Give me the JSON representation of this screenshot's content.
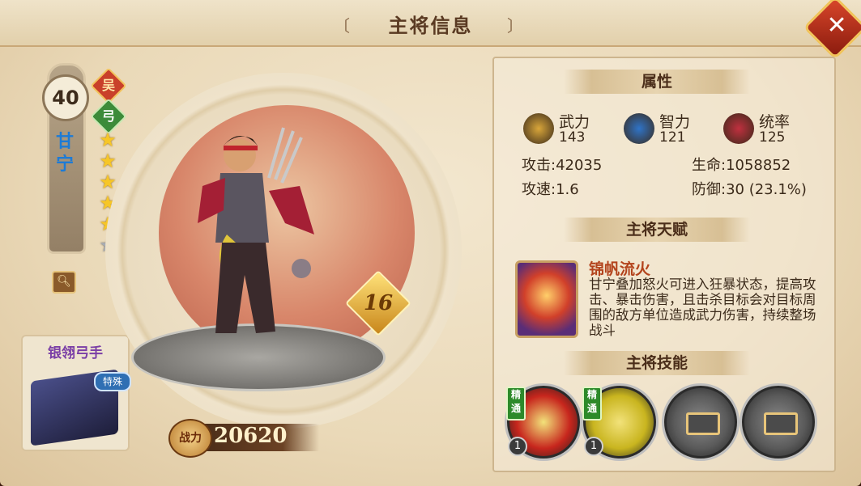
{
  "header": {
    "title": "主将信息",
    "close_label": "✕"
  },
  "hero": {
    "level": "40",
    "name": "甘宁",
    "badge_top": "吴",
    "badge_second": "弓",
    "stars": [
      true,
      true,
      true,
      true,
      true,
      false
    ],
    "star_glyph": "★",
    "rank_badge": "16",
    "power_label": "战力",
    "power_value": "20620"
  },
  "troop": {
    "name": "银翎弓手",
    "tag": "特殊"
  },
  "attributes": {
    "section_title": "属性",
    "items": [
      {
        "label": "武力",
        "value": "143",
        "icon": "sword-icon",
        "color": "#d9a63a"
      },
      {
        "label": "智力",
        "value": "121",
        "icon": "scroll-icon",
        "color": "#2f74c8"
      },
      {
        "label": "统率",
        "value": "125",
        "icon": "banner-icon",
        "color": "#c0303f"
      }
    ],
    "stats": {
      "attack": "攻击:42035",
      "hp": "生命:1058852",
      "attack_speed": "攻速:1.6",
      "defense": "防御:30 (23.1%)"
    }
  },
  "talent": {
    "section_title": "主将天赋",
    "name": "锦帆流火",
    "description": "甘宁叠加怒火可进入狂暴状态，提高攻击、暴击伤害，且击杀目标会对目标周围的敌方单位造成武力伤害，持续整场战斗"
  },
  "skills": {
    "section_title": "主将技能",
    "items": [
      {
        "tag": "精通",
        "level": "1",
        "locked": false,
        "color": "#c7261d"
      },
      {
        "tag": "精通",
        "level": "1",
        "locked": false,
        "color": "#c9b51f"
      },
      {
        "tag": "",
        "level": "",
        "locked": true,
        "color": "#5a5a5a"
      },
      {
        "tag": "",
        "level": "",
        "locked": true,
        "color": "#5a5a5a"
      }
    ]
  }
}
